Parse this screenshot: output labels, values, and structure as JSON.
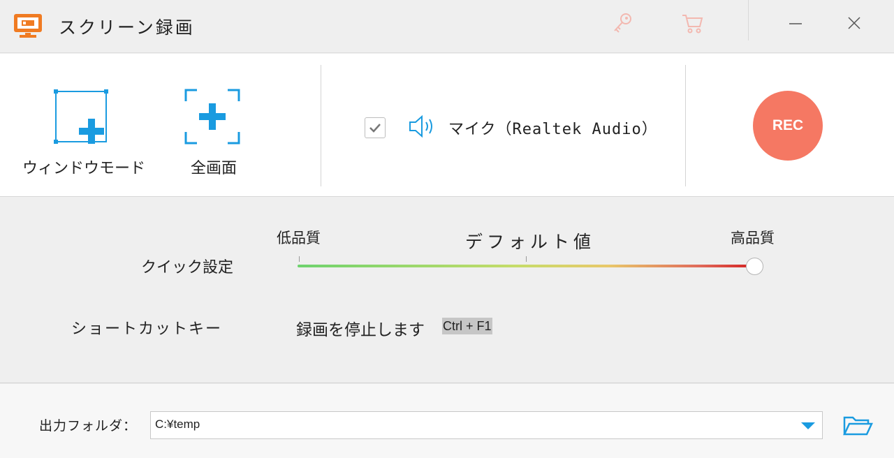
{
  "window": {
    "title": "スクリーン録画"
  },
  "modes": {
    "window_mode_label": "ウィンドウモード",
    "fullscreen_label": "全画面"
  },
  "audio": {
    "mic_checked": true,
    "mic_label": "マイク（Realtek Audio）"
  },
  "record": {
    "rec_label": "REC"
  },
  "quick_settings": {
    "label": "クイック設定",
    "low_label": "低品質",
    "default_label": "デフォルト値",
    "high_label": "高品質",
    "quality_fraction": 1.0
  },
  "shortcut": {
    "label": "ショートカットキー",
    "stop_text": "録画を停止します",
    "hotkey": "Ctrl + F1"
  },
  "output": {
    "label": "出力フォルダ：",
    "path": "C:¥temp"
  },
  "colors": {
    "accent_blue": "#1a9be0",
    "rec_red": "#f57863",
    "app_orange": "#f07b22",
    "disabled_pink": "#f3b8b0"
  },
  "icons": {
    "app": "screen-recorder-icon",
    "key": "key-icon",
    "cart": "cart-icon",
    "minimize": "minimize-icon",
    "close": "close-icon",
    "window_mode": "window-mode-icon",
    "fullscreen": "fullscreen-icon",
    "checkbox": "checkmark-icon",
    "speaker": "speaker-icon",
    "dropdown": "chevron-down-icon",
    "folder": "folder-open-icon"
  }
}
